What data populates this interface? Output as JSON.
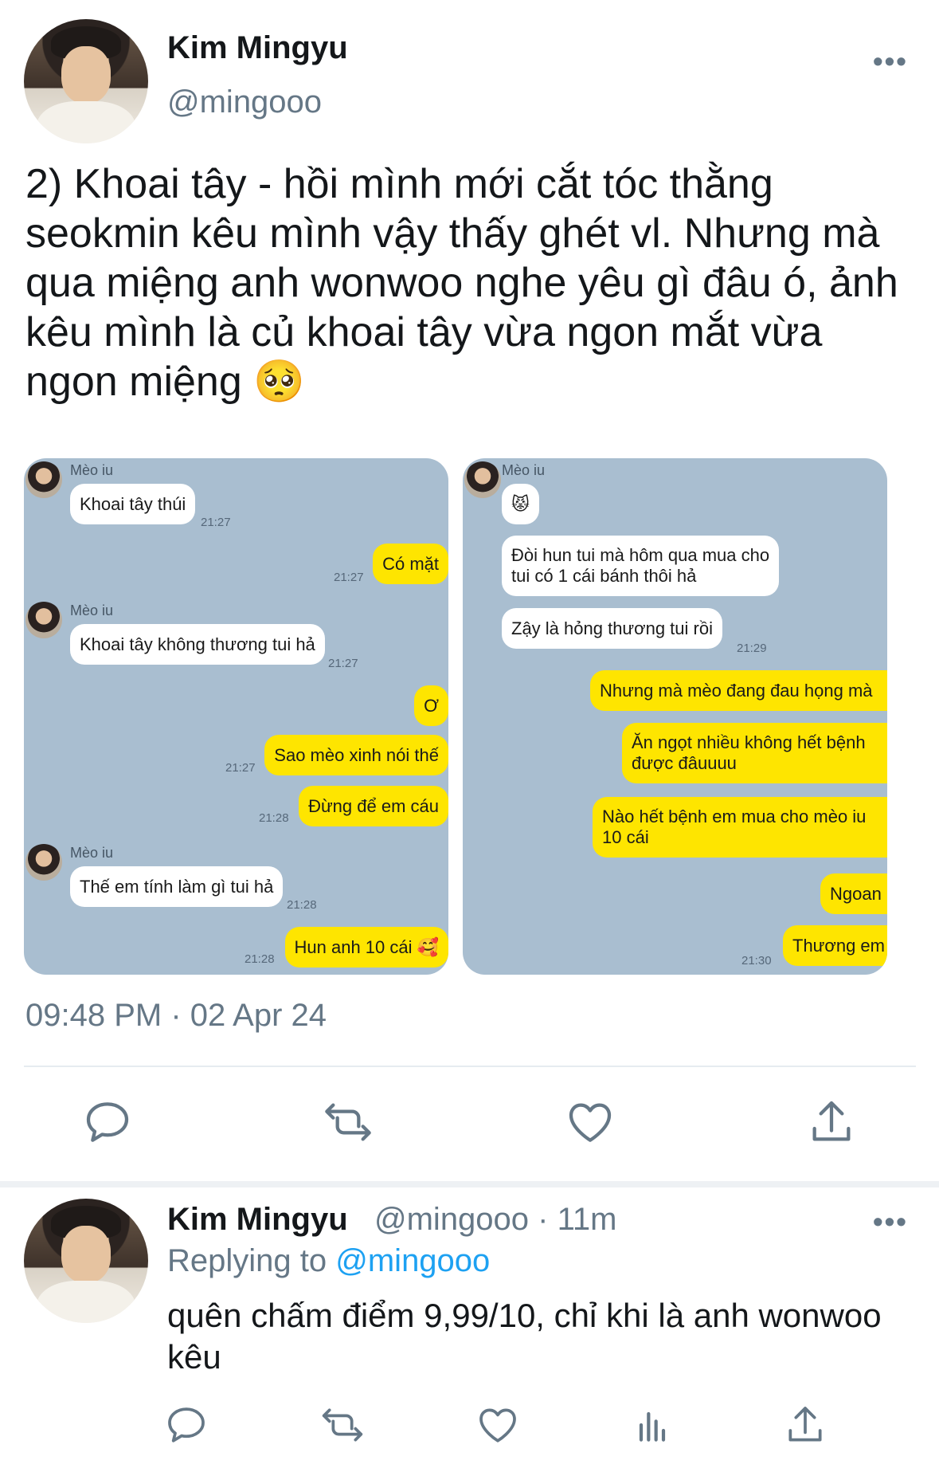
{
  "tweet": {
    "author_name": "Kim Mingyu",
    "author_handle": "@mingooo",
    "more": "•••",
    "text": "2) Khoai tây - hồi mình mới cắt tóc thằng seokmin kêu mình vậy thấy ghét vl. Nhưng mà qua miệng anh wonwoo nghe yêu gì đâu ó, ảnh kêu mình là củ khoai tây vừa ngon mắt vừa ngon miệng 🥺",
    "timestamp": "09:48 PM · 02 Apr 24"
  },
  "screenshot_left": {
    "sender": "Mèo iu",
    "messages": [
      {
        "text": "Khoai tây thúi",
        "time": "21:27"
      },
      {
        "text": "Có mặt",
        "time": "21:27"
      },
      {
        "text": "Khoai tây không thương tui hả",
        "time": "21:27"
      },
      {
        "text": "Ơ",
        "time": ""
      },
      {
        "text": "Sao mèo xinh nói thế",
        "time": "21:27"
      },
      {
        "text": "Đừng để em cáu",
        "time": "21:28"
      },
      {
        "text": "Thế em tính làm gì tui hả",
        "time": "21:28"
      },
      {
        "text": "Hun anh 10 cái 🥰",
        "time": "21:28"
      }
    ]
  },
  "screenshot_right": {
    "sender": "Mèo iu",
    "messages": [
      {
        "text": "😾",
        "time": ""
      },
      {
        "text": "Đòi hun tui mà hôm qua mua cho\ntui có 1 cái bánh thôi hả",
        "time": ""
      },
      {
        "text": "Zậy là hỏng thương tui rồi",
        "time": "21:29"
      },
      {
        "text": "Nhưng mà mèo đang đau họng mà",
        "time": ""
      },
      {
        "text": "Ăn ngọt nhiều không hết bệnh\nđược đâuuuu",
        "time": ""
      },
      {
        "text": "Nào hết bệnh em mua cho mèo iu\n10 cái",
        "time": ""
      },
      {
        "text": "Ngoan",
        "time": ""
      },
      {
        "text": "Thương em",
        "time": "21:30"
      }
    ]
  },
  "actions": [
    "reply-icon",
    "retweet-icon",
    "like-icon",
    "share-icon"
  ],
  "reply": {
    "author_name": "Kim Mingyu",
    "meta": "@mingooo · 11m",
    "replying_prefix": "Replying to",
    "replying_to": "@mingooo",
    "more": "•••",
    "text": "quên chấm điểm 9,99/10, chỉ khi là anh wonwoo kêu",
    "actions": [
      "reply-icon",
      "retweet-icon",
      "like-icon",
      "analytics-icon",
      "share-icon"
    ]
  },
  "colors": {
    "text": "#14171a",
    "secondary": "#657786",
    "link": "#1da1f2",
    "chat_bg": "#a9bed0",
    "bubble_yellow": "#fee500"
  }
}
